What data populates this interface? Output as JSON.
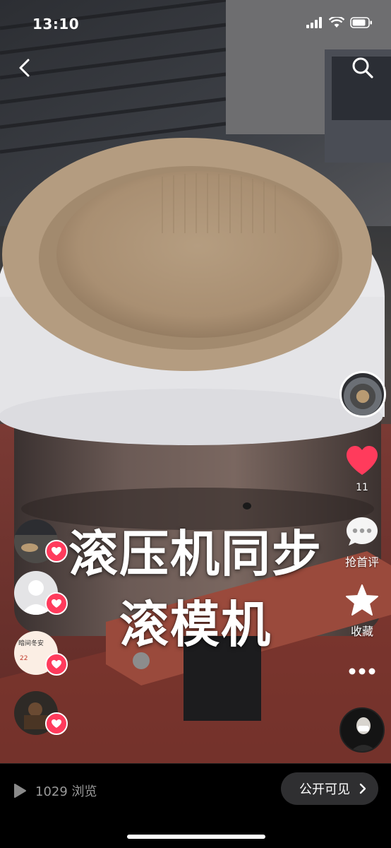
{
  "status_bar": {
    "time": "13:10"
  },
  "caption": {
    "line1": "滚压机同步",
    "line2": "滚模机"
  },
  "actions": {
    "like_count": "11",
    "comment_label": "抢首评",
    "favorite_label": "收藏"
  },
  "viewers": [
    {
      "name": "viewer-1"
    },
    {
      "name": "viewer-2"
    },
    {
      "name": "viewer-3",
      "card_title": "暗间冬安",
      "card_num": "22"
    },
    {
      "name": "viewer-4"
    }
  ],
  "bottom": {
    "views_text": "1029 浏览",
    "visibility_label": "公开可见"
  },
  "colors": {
    "like": "#ff3b5c",
    "bottom_bg": "#000000",
    "pill_bg": "#2f2f31"
  },
  "icons": [
    "back-icon",
    "search-icon",
    "heart-icon",
    "comment-icon",
    "star-icon",
    "more-icon",
    "play-icon",
    "chevron-right-icon"
  ]
}
